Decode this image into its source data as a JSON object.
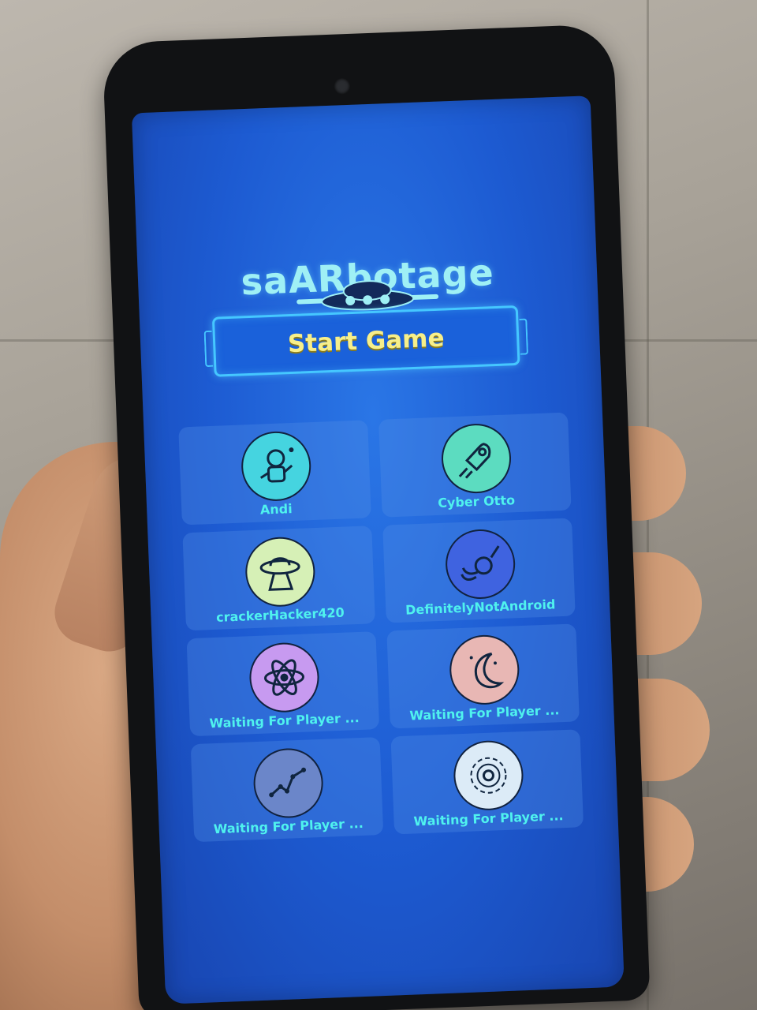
{
  "app": {
    "logo_text": "saARbotage",
    "start_button_label": "Start Game"
  },
  "players": [
    {
      "name": "Andi",
      "icon": "astronaut-icon",
      "color": "#45d4e0"
    },
    {
      "name": "Cyber Otto",
      "icon": "rocket-icon",
      "color": "#5cdcc0"
    },
    {
      "name": "crackerHacker420",
      "icon": "ufo-icon",
      "color": "#d6f0b6"
    },
    {
      "name": "DefinitelyNotAndroid",
      "icon": "comet-icon",
      "color": "#3f63e0"
    },
    {
      "name": "Waiting For Player ...",
      "icon": "atom-icon",
      "color": "#c79af0"
    },
    {
      "name": "Waiting For Player ...",
      "icon": "moon-icon",
      "color": "#e8b7b4"
    },
    {
      "name": "Waiting For Player ...",
      "icon": "constellation-icon",
      "color": "#6b86c9"
    },
    {
      "name": "Waiting For Player ...",
      "icon": "galaxy-icon",
      "color": "#dcebf7"
    }
  ]
}
